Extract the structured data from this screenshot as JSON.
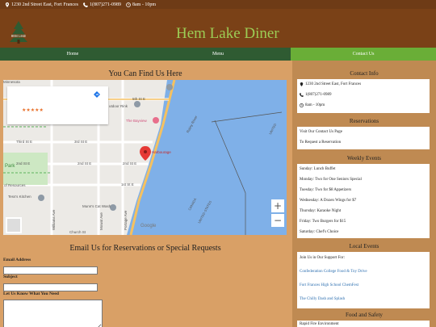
{
  "topbar": {
    "address": "1230 2nd Street East, Fort Frances",
    "phone": "1(807)271-0989",
    "hours": "8am - 10pm"
  },
  "header": {
    "logo_text": "HEM LAKE",
    "title": "Hem Lake Diner"
  },
  "nav": {
    "items": [
      {
        "label": "Home"
      },
      {
        "label": "Menu"
      },
      {
        "label": "Contact Us"
      }
    ]
  },
  "find": {
    "title": "You Can Find Us Here"
  },
  "map": {
    "rating": "★★★★★",
    "places": {
      "bayview": "The Bayview",
      "harbourage": "Harbourage",
      "rink": "utdoor Rink",
      "tess": "Tess's Kitchen",
      "munns": "Munn's Cat Wash",
      "park": "Park",
      "resources": "of Resources",
      "minnesota": "Minnesota",
      "church": "Church St"
    },
    "streets": {
      "fifth": "5th St E",
      "third": "Third St E",
      "third2": "3rd St E",
      "second": "2nd St E",
      "second2": "2nd St E",
      "second3": "2nd St E",
      "first": "1st St E",
      "rainy": "Rainy River",
      "canada": "CANADA",
      "us": "UNITED STATES",
      "us2": "UNITED",
      "williams": "Williams Ave",
      "mowat": "Mowat Ave",
      "portage": "Portage Ave"
    },
    "zoom_in": "+",
    "zoom_out": "−",
    "google": "Google"
  },
  "form": {
    "title": "Email Us for Reservations or Special Requests",
    "email_label": "Email Address",
    "subject_label": "Subject",
    "message_label": "Let Us Know What You Need"
  },
  "sidebar": {
    "contact": {
      "heading": "Contact Info",
      "address": "1230 2nd Street East, Fort Frances",
      "phone": "1(807)271-0989",
      "hours": "8am - 10pm"
    },
    "reservations": {
      "heading": "Reservations",
      "line1": "Visit Our Contact Us Page",
      "line2": "To Request a Reservation"
    },
    "weekly": {
      "heading": "Weekly Events",
      "items": [
        "Sunday: Lunch Buffet",
        "Monday: Two for One Seniors Special",
        "Tuesday: Two for $8 Appetizers",
        "Wednesday: A Dozen Wings for $7",
        "Thursday: Karaoke Night",
        "Friday: Two Burgers for $15",
        "Saturday: Chef's Choice"
      ]
    },
    "local": {
      "heading": "Local Events",
      "intro": "Join Us in Our Support For:",
      "links": [
        "Confederation College Food & Toy Drive",
        "Fort Frances High School ChemFest",
        "The Chilly Dash and Splash"
      ]
    },
    "food": {
      "heading": "Food and Safety",
      "line": "Rapid Fire Environment"
    }
  },
  "colors": {
    "topbar": "#6e3b16",
    "header": "#7a4117",
    "title": "#9ccc55",
    "nav": "#2f5b32",
    "nav_active": "#6aae37",
    "page": "#d9a066",
    "sidebar": "#bf8a52",
    "link": "#2d6fb0"
  }
}
